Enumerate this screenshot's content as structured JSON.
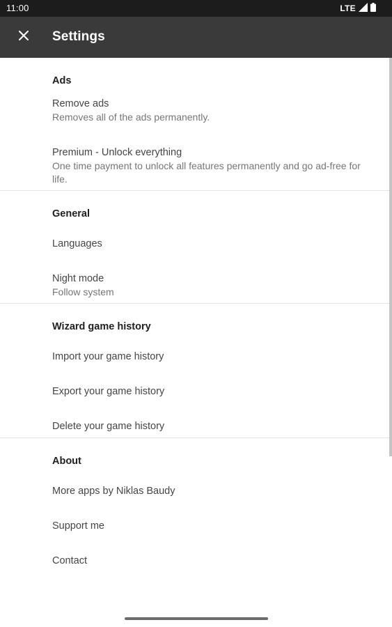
{
  "status_bar": {
    "time": "11:00",
    "network": "LTE",
    "icons": [
      "signal-icon",
      "battery-icon"
    ]
  },
  "app_bar": {
    "title": "Settings",
    "close_icon": "close-icon"
  },
  "sections": [
    {
      "header": "Ads",
      "items": [
        {
          "title": "Remove ads",
          "summary": "Removes all of the ads permanently."
        },
        {
          "title": "Premium - Unlock everything",
          "summary": "One time payment to unlock all features permanently and go ad-free for life."
        }
      ]
    },
    {
      "header": "General",
      "items": [
        {
          "title": "Languages"
        },
        {
          "title": "Night mode",
          "summary": "Follow system"
        }
      ]
    },
    {
      "header": "Wizard game history",
      "items": [
        {
          "title": "Import your game history"
        },
        {
          "title": "Export your game history"
        },
        {
          "title": "Delete your game history"
        }
      ]
    },
    {
      "header": "About",
      "items": [
        {
          "title": "More apps by Niklas Baudy"
        },
        {
          "title": "Support me"
        },
        {
          "title": "Contact"
        }
      ]
    }
  ]
}
